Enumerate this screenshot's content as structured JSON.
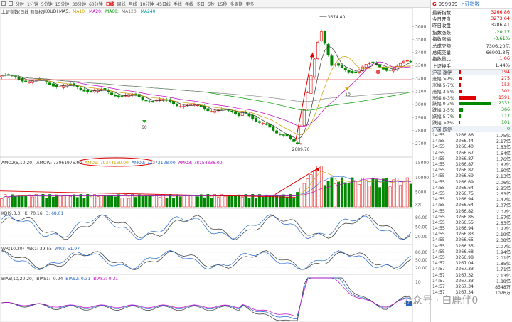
{
  "toolbar": {
    "tabs": [
      "分时",
      "1分钟",
      "5分钟",
      "15分钟",
      "30分钟",
      "60分钟",
      "日线",
      "周线",
      "月线",
      "10分钟",
      "45日线",
      "季线",
      "年线",
      "多日",
      "5秒",
      "15秒",
      "多周期",
      "更多"
    ],
    "active": 6,
    "right": [
      "全屏",
      "F10",
      "自选",
      "论股"
    ]
  },
  "main": {
    "title": "上证指数(日线 前复权)",
    "ma": [
      {
        "label": "KOUDI MA5:",
        "value": "3290.96",
        "color": "#333333"
      },
      {
        "label": "MA10:",
        "value": "3274.25",
        "color": "#c8a000"
      },
      {
        "label": "MA20:",
        "value": "3256.22",
        "color": "#c000c0"
      },
      {
        "label": "MA60:",
        "value": "2970.76",
        "color": "#009900"
      },
      {
        "label": "MA120:",
        "value": "3001.45",
        "color": "#707070"
      },
      {
        "label": "MA240:",
        "value": "2951.40",
        "color": "#00a0a0"
      }
    ],
    "yaxis": [
      "3600",
      "3500",
      "3400",
      "3300",
      "3200",
      "3100",
      "3000",
      "2900",
      "2800",
      "2700"
    ],
    "annot_high": "3674.40",
    "annot_low": "2689.70",
    "marker_60": "60",
    "marker_10": "10"
  },
  "amo": {
    "title": "AMO2(5,10,20)",
    "legend": [
      {
        "label": "AMOW: 73061976.00",
        "color": "#333333"
      },
      {
        "label": "AMO1: 70344160.00",
        "color": "#c8a000"
      },
      {
        "label": "AMO2: 72172128.00",
        "color": "#2266cc"
      },
      {
        "label": "AMO3: 78154336.00",
        "color": "#c000c0"
      }
    ],
    "yaxis": [
      "15000",
      "10000",
      "5000"
    ],
    "unit": "X万"
  },
  "kdj": {
    "title": "KD(9,3,3)",
    "legend": [
      {
        "label": "K: 70.16",
        "color": "#333333"
      },
      {
        "label": "D: 68.01",
        "color": "#2266cc"
      }
    ],
    "yaxis": [
      "80.00",
      "50.00",
      "20.00"
    ]
  },
  "wr": {
    "title": "WR(10,20)",
    "legend": [
      {
        "label": "WR1: 39.55",
        "color": "#333333"
      },
      {
        "label": "WR2: 51.97",
        "color": "#2266cc"
      }
    ],
    "yaxis": [
      "80.00",
      "50.00",
      "20.00"
    ]
  },
  "bias": {
    "title": "BIAS(10,20,20)",
    "legend": [
      {
        "label": "BIAS1: -0.24",
        "color": "#333333"
      },
      {
        "label": "BIAS2: 0.31",
        "color": "#2266cc"
      },
      {
        "label": "BIAS3: 0.31",
        "color": "#c000c0"
      }
    ],
    "yaxis": [
      "10",
      "0"
    ],
    "tag": "-0.3"
  },
  "right_panel": {
    "code": "999999",
    "name": "上证指数",
    "stats": [
      {
        "label": "最新指数",
        "value": "3266.86",
        "cls": "red"
      },
      {
        "label": "今日开盘",
        "value": "3273.64",
        "cls": "red"
      },
      {
        "label": "昨日收盘",
        "value": "3286.41",
        "cls": ""
      },
      {
        "label": "指数涨跌",
        "value": "-20.17",
        "cls": "green"
      },
      {
        "label": "指数涨幅",
        "value": "-0.61%",
        "cls": "green"
      },
      {
        "label": "总成交额",
        "value": "7306.20亿",
        "cls": ""
      },
      {
        "label": "总成交量",
        "value": "66901.8万",
        "cls": ""
      },
      {
        "label": "指数量比",
        "value": "1.06",
        "cls": "red"
      },
      {
        "label": "上证换手",
        "value": "1.44%",
        "cls": ""
      }
    ],
    "breadth": [
      {
        "label": "沪深 涨停",
        "value": "194",
        "cls": "red",
        "bar": 0.05,
        "color": "#e00000",
        "sect": true
      },
      {
        "label": "涨幅 >7%",
        "value": "275",
        "cls": "red",
        "bar": 0.07,
        "color": "#e00000"
      },
      {
        "label": "涨幅 5-7%",
        "value": "152",
        "cls": "red",
        "bar": 0.04,
        "color": "#e00000"
      },
      {
        "label": "涨幅 3-5%",
        "value": "302",
        "cls": "red",
        "bar": 0.08,
        "color": "#e00000"
      },
      {
        "label": "涨幅 0-3%",
        "value": "1591",
        "cls": "red",
        "bar": 0.55,
        "color": "#e00000"
      },
      {
        "label": "跌幅 0-3%",
        "value": "2332",
        "cls": "green",
        "bar": 1.0,
        "color": "#008800"
      },
      {
        "label": "跌幅 3-5%",
        "value": "366",
        "cls": "green",
        "bar": 0.12,
        "color": "#008800"
      },
      {
        "label": "跌幅 5-7%",
        "value": "117",
        "cls": "green",
        "bar": 0.04,
        "color": "#008800"
      },
      {
        "label": "跌幅 >7%",
        "value": "101",
        "cls": "green",
        "bar": 0.03,
        "color": "#008800"
      },
      {
        "label": "沪深 跌停",
        "value": "0",
        "cls": "green",
        "bar": 0,
        "color": "#008800",
        "sect": true
      }
    ],
    "ticks": [
      [
        "14:55",
        "3266.86",
        "1.75亿"
      ],
      [
        "14:55",
        "3266.44",
        "2.17亿"
      ],
      [
        "14:55",
        "3266.40",
        "1.83亿"
      ],
      [
        "14:55",
        "3266.67",
        "1.64亿"
      ],
      [
        "14:55",
        "3266.87",
        "1.76亿"
      ],
      [
        "14:55",
        "3266.87",
        "1.87亿"
      ],
      [
        "14:55",
        "3266.82",
        "1.60亿"
      ],
      [
        "14:55",
        "3266.69",
        "2.13亿"
      ],
      [
        "14:55",
        "3266.69",
        "2.06亿"
      ],
      [
        "14:55",
        "3266.64",
        "2.95亿"
      ],
      [
        "14:55",
        "3266.75",
        "2.63亿"
      ],
      [
        "14:55",
        "3266.94",
        "1.47亿"
      ],
      [
        "14:55",
        "3266.64",
        "2.07亿"
      ],
      [
        "14:55",
        "3266.82",
        "2.07亿"
      ],
      [
        "14:55",
        "3266.86",
        "1.57亿"
      ],
      [
        "14:55",
        "3266.55",
        "2.83亿"
      ],
      [
        "14:55",
        "3266.94",
        "1.97亿"
      ],
      [
        "14:55",
        "3266.83",
        "2.19亿"
      ],
      [
        "14:55",
        "3266.65",
        "2.08亿"
      ],
      [
        "14:55",
        "3266.55",
        "2.07亿"
      ],
      [
        "14:55",
        "3266.68",
        "1.94亿"
      ],
      [
        "14:55",
        "3266.98",
        "2.01亿"
      ],
      [
        "14:57",
        "3267.04",
        "1.85亿"
      ],
      [
        "14:57",
        "3267.33",
        "1.71亿"
      ],
      [
        "14:57",
        "3267.32",
        "2.13亿"
      ],
      [
        "14:57",
        "3267.33",
        "1.88亿"
      ],
      [
        "14:57",
        "3267.34",
        "8548万"
      ],
      [
        "14:57",
        "3267.34",
        "1076万"
      ]
    ]
  },
  "watermark": "公众号 · 白鹿伴0"
}
